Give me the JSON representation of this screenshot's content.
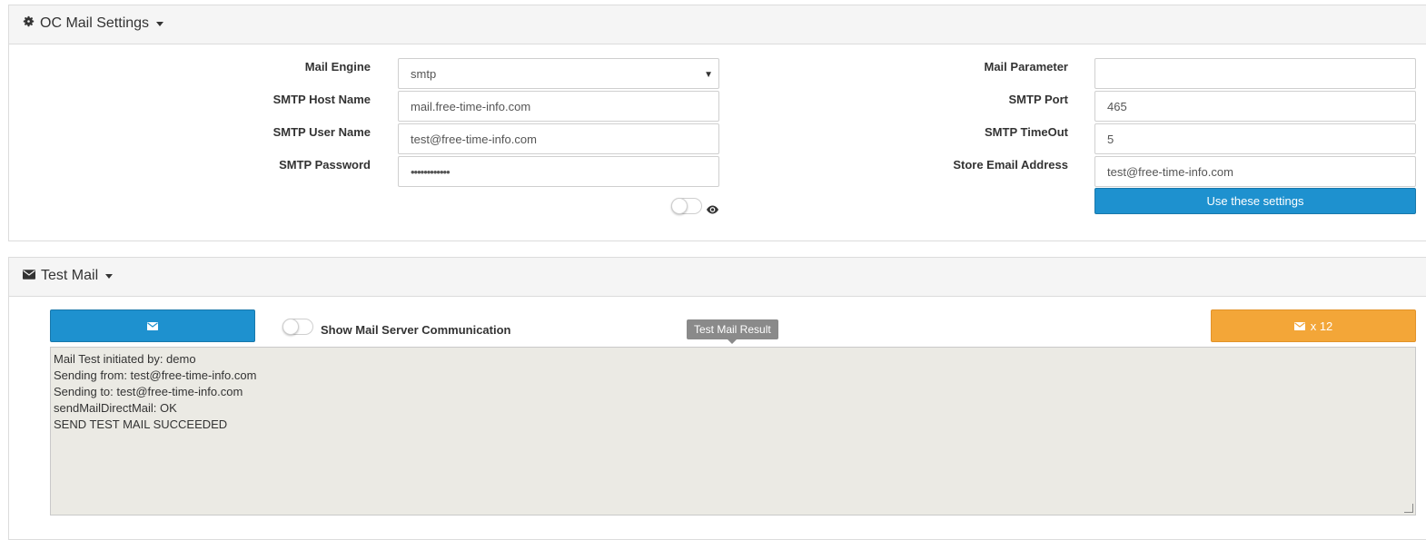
{
  "settings_panel": {
    "title": "OC Mail Settings",
    "fields": {
      "mail_engine_label": "Mail Engine",
      "mail_engine_value": "smtp",
      "host_label": "SMTP Host Name",
      "host_value": "mail.free-time-info.com",
      "user_label": "SMTP User Name",
      "user_value": "test@free-time-info.com",
      "password_label": "SMTP Password",
      "password_value": "••••••••••••",
      "parameter_label": "Mail Parameter",
      "parameter_value": "",
      "port_label": "SMTP Port",
      "port_value": "465",
      "timeout_label": "SMTP TimeOut",
      "timeout_value": "5",
      "store_email_label": "Store Email Address",
      "store_email_value": "test@free-time-info.com"
    },
    "use_settings_button": "Use these settings",
    "show_password_icon": "eye-icon"
  },
  "test_panel": {
    "title": "Test Mail",
    "send_icon": "envelope-icon",
    "show_comm_label": "Show Mail Server Communication",
    "tooltip": "Test Mail Result",
    "bulk_button_label": "x 12",
    "result_lines": [
      "Mail Test initiated by: demo",
      "Sending from: test@free-time-info.com",
      "Sending to: test@free-time-info.com",
      "sendMailDirectMail: OK",
      "SEND TEST MAIL SUCCEEDED"
    ]
  },
  "colors": {
    "primary": "#1e91cf",
    "warning": "#f3a638",
    "result_bg": "#ebeae4"
  }
}
